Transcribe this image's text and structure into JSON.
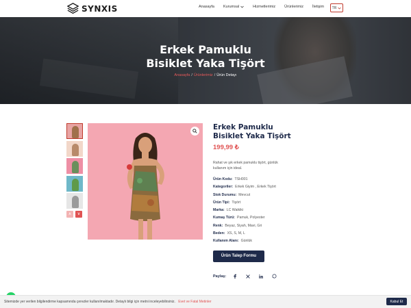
{
  "brand": {
    "name": "SYNXIS"
  },
  "nav": {
    "items": [
      "Anasayfa",
      "Kurumsal",
      "Hizmetlerimiz",
      "Ürünlerimiz",
      "İletişim"
    ],
    "lang": "TR"
  },
  "hero": {
    "title_line1": "Erkek Pamuklu",
    "title_line2": "Bisiklet Yaka Tişört",
    "breadcrumb": [
      "Anasayfa",
      "Ürünlerimiz",
      "Ürün Detayı"
    ],
    "breadcrumb_sep": "/"
  },
  "product": {
    "title_line1": "Erkek Pamuklu",
    "title_line2": "Bisiklet Yaka Tişört",
    "price": "199,99 ₺",
    "description": "Rahat ve şık erkek pamuklu tişört, günlük kullanım için ideal.",
    "specs": [
      {
        "key": "Ürün Kodu:",
        "value": "TSH001"
      },
      {
        "key": "Kategoriler:",
        "value": "Erkek Giyim , Erkek Tişört"
      },
      {
        "key": "Stok Durumu:",
        "value": "Mevcut"
      },
      {
        "key": "Ürün Tipi:",
        "value": "Tişört"
      },
      {
        "key": "Marka:",
        "value": "LC Waikiki"
      },
      {
        "key": "Kumaş Türü:",
        "value": "Pamuk, Polyester"
      },
      {
        "key": "Renk:",
        "value": "Beyaz, Siyah, Mavi, Gri"
      },
      {
        "key": "Beden:",
        "value": "XS, S, M, L"
      },
      {
        "key": "Kullanım Alanı:",
        "value": "Günlük"
      }
    ],
    "cta_label": "Ürün Talep Formu",
    "share_label": "Paylaş:",
    "share_icons": [
      "facebook-icon",
      "x-icon",
      "linkedin-icon",
      "whatsapp-icon"
    ]
  },
  "gallery": {
    "thumb_colors": [
      "#e8a4a4",
      "#f2d7c9",
      "#ee8fa5",
      "#6fb8c9",
      "#e6e6e6"
    ],
    "arrow_up": "∧",
    "arrow_down": "∨"
  },
  "cookie": {
    "text": "Sitemizde yer verilen bilgilendirme kapsamında çerezler kullanılmaktadır. Detaylı bilgi için metni inceleyebilirsiniz.",
    "link": "Evet ve Fatal Metinler",
    "button": "Kabul Et"
  },
  "colors": {
    "accent": "#e05353",
    "navy": "#1e2a4a"
  }
}
